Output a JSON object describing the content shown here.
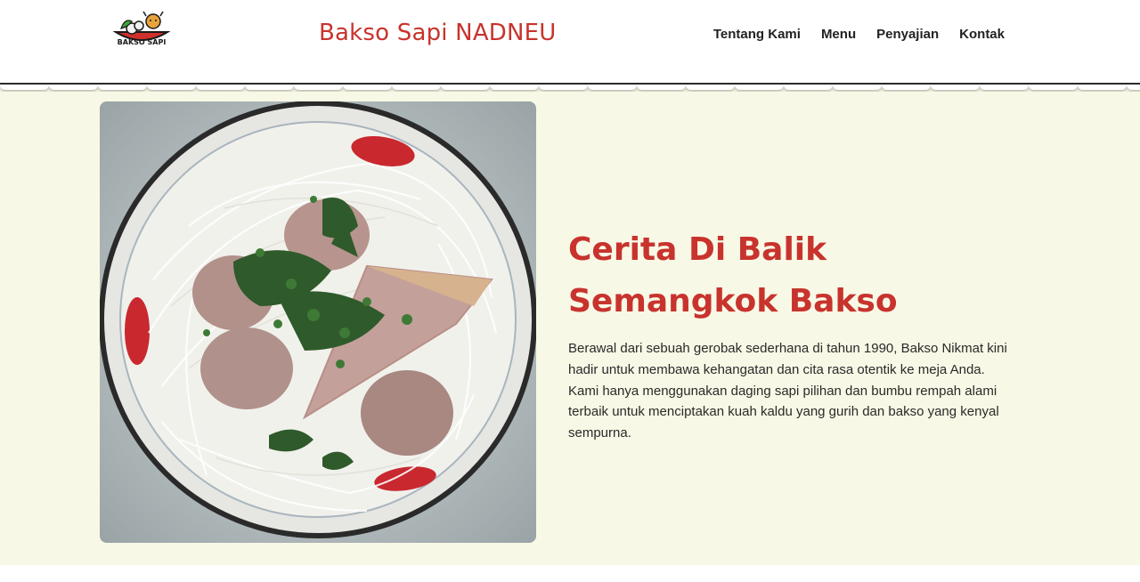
{
  "header": {
    "logo_text": "BAKSO SAPI",
    "brand_title": "Bakso Sapi NADNEU",
    "nav": [
      "Tentang Kami",
      "Menu",
      "Penyajian",
      "Kontak"
    ]
  },
  "hero": {
    "headline": "Cerita Di Balik Semangkok Bakso",
    "body": "Berawal dari sebuah gerobak sederhana di tahun 1990, Bakso Nikmat kini hadir untuk membawa kehangatan dan cita rasa otentik ke meja Anda. Kami hanya menggunakan daging sapi pilihan dan bumbu rempah alami terbaik untuk menciptakan kuah kaldu yang gurih dan bakso yang kenyal sempurna."
  },
  "colors": {
    "brand_red": "#c8332d",
    "hero_bg": "#f8f8e6",
    "nav_text": "#222222"
  }
}
